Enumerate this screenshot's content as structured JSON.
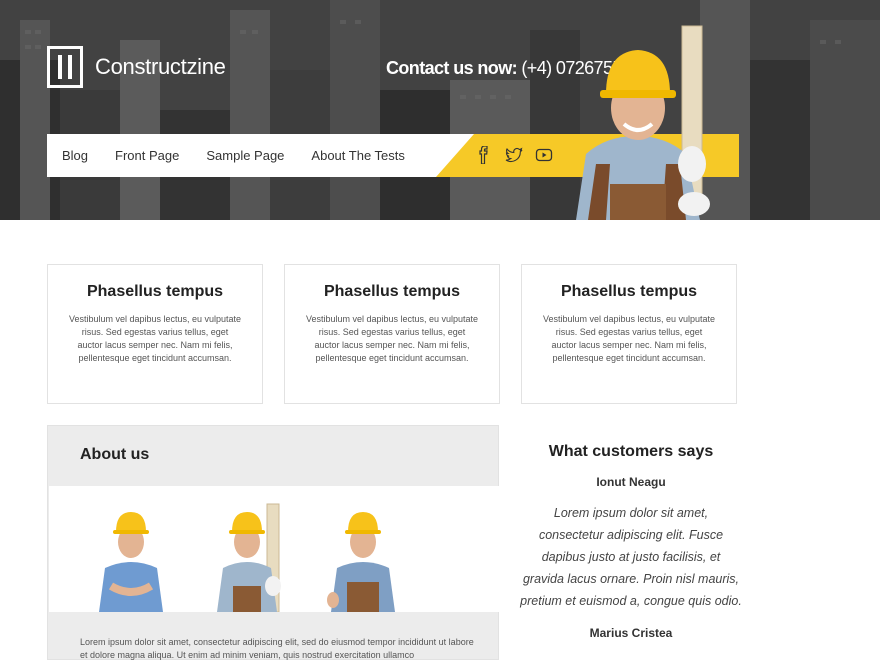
{
  "header": {
    "site_name": "Constructzine",
    "contact_label": "Contact us now:",
    "contact_phone": "(+4) 0726755577"
  },
  "nav": {
    "items": [
      {
        "label": "Blog"
      },
      {
        "label": "Front Page"
      },
      {
        "label": "Sample Page"
      },
      {
        "label": "About The Tests"
      }
    ],
    "social": [
      "facebook-icon",
      "twitter-icon",
      "youtube-icon"
    ]
  },
  "features": [
    {
      "title": "Phasellus tempus",
      "text": "Vestibulum vel dapibus lectus, eu vulputate risus. Sed egestas varius tellus, eget auctor lacus semper nec. Nam mi felis, pellentesque eget tincidunt accumsan."
    },
    {
      "title": "Phasellus tempus",
      "text": "Vestibulum vel dapibus lectus, eu vulputate risus. Sed egestas varius tellus, eget auctor lacus semper nec. Nam mi felis, pellentesque eget tincidunt accumsan."
    },
    {
      "title": "Phasellus tempus",
      "text": "Vestibulum vel dapibus lectus, eu vulputate risus. Sed egestas varius tellus, eget auctor lacus semper nec. Nam mi felis, pellentesque eget tincidunt accumsan."
    }
  ],
  "about": {
    "title": "About us",
    "text": "Lorem ipsum dolor sit amet, consectetur adipiscing elit, sed do eiusmod tempor incididunt ut labore et dolore magna aliqua. Ut enim ad minim veniam, quis nostrud exercitation ullamco"
  },
  "testimonials": {
    "title": "What customers says",
    "items": [
      {
        "name": "Ionut Neagu",
        "quote": "Lorem ipsum dolor sit amet, consectetur adipiscing elit. Fusce dapibus justo at justo facilisis, et gravida lacus ornare. Proin nisl mauris, pretium et euismod a, congue quis odio."
      },
      {
        "name": "Marius Cristea",
        "quote": ""
      }
    ]
  },
  "colors": {
    "accent": "#f6c927",
    "header_bg": "#3e3e3e"
  }
}
